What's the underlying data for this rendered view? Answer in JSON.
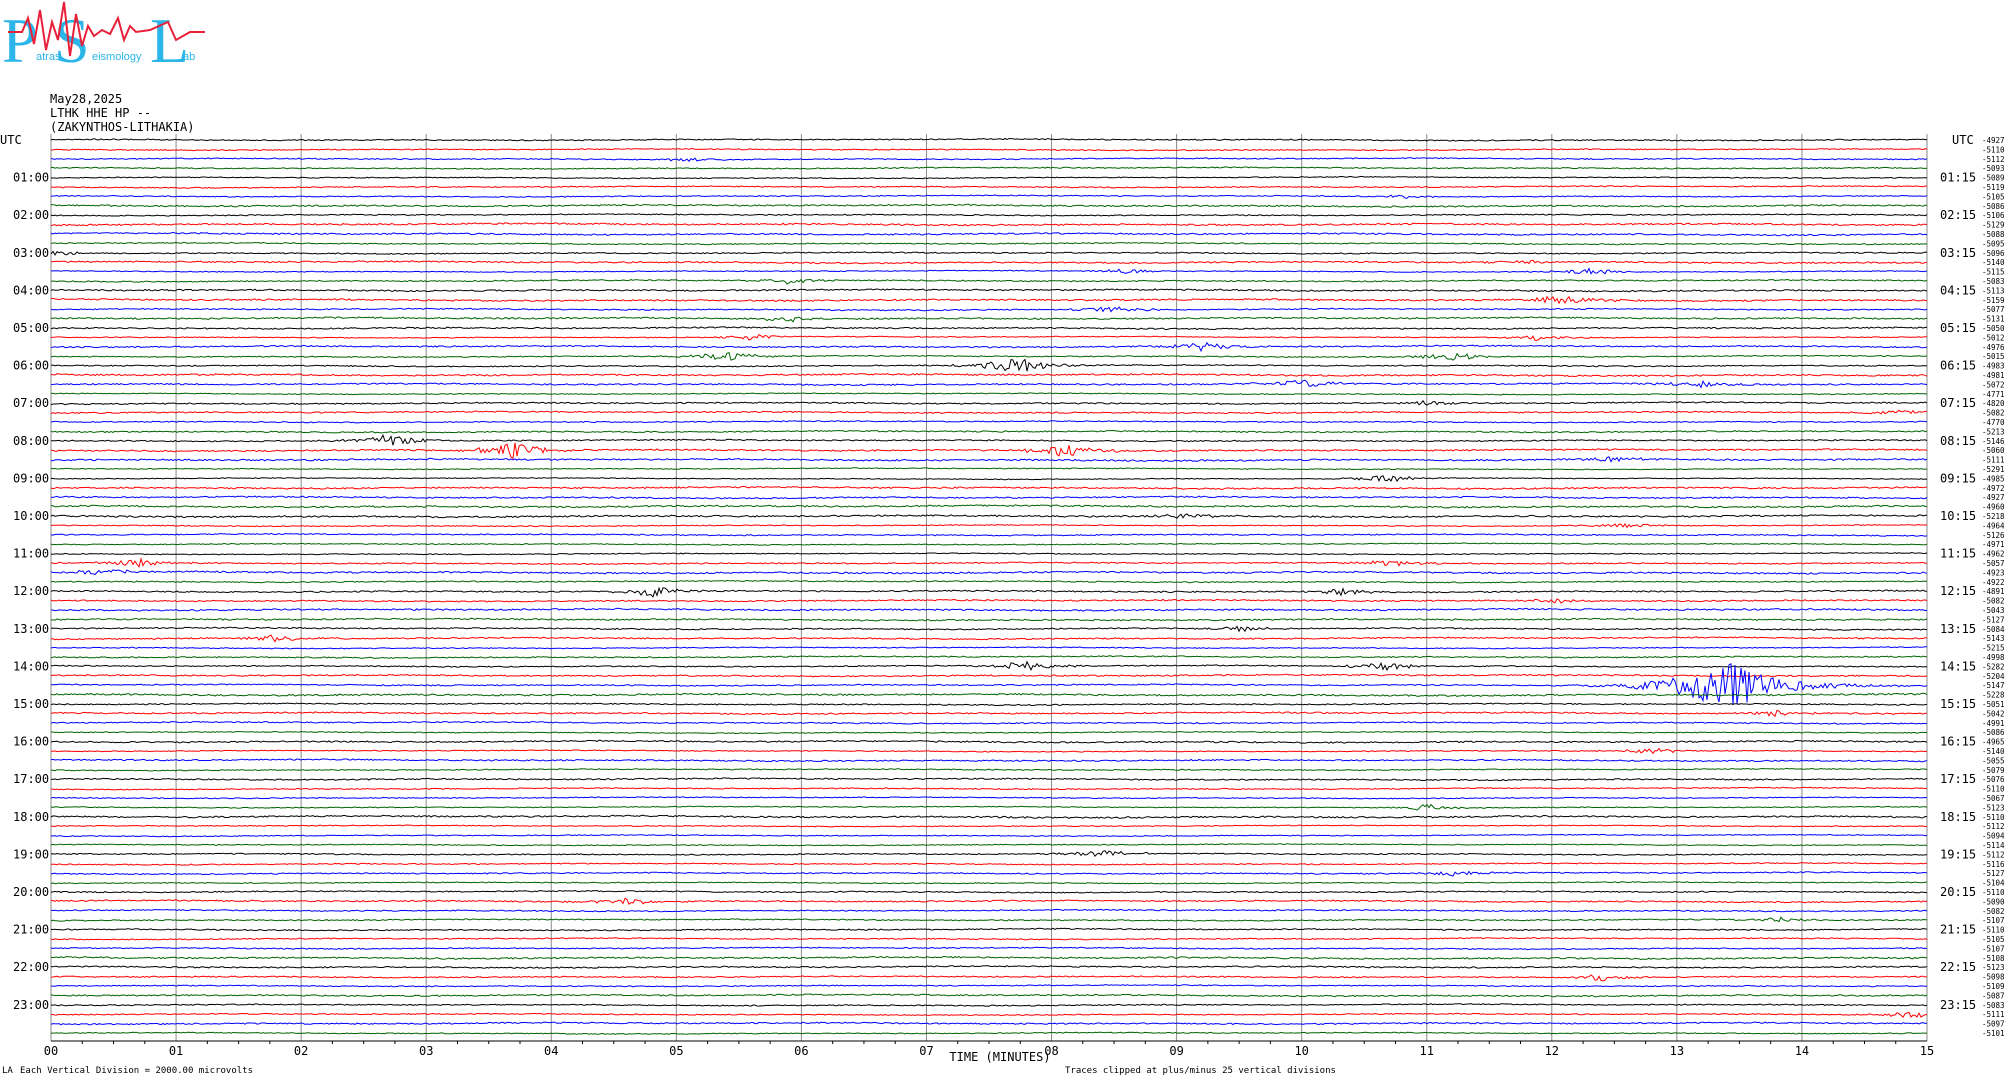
{
  "logo": {
    "big_letters": [
      "P",
      "S",
      "L"
    ],
    "small_words": [
      "atras",
      "eismology",
      "ab"
    ],
    "colors": {
      "letters": "#2bb5e8",
      "wave": "#e8213a"
    }
  },
  "header": {
    "date": "May28,2025",
    "station": "LTHK HHE HP --",
    "location": "(ZAKYNTHOS-LITHAKIA)"
  },
  "utc_label_left": "UTC",
  "utc_label_right": "UTC",
  "hour_labels_left": [
    "01:00",
    "02:00",
    "03:00",
    "04:00",
    "05:00",
    "06:00",
    "07:00",
    "08:00",
    "09:00",
    "10:00",
    "11:00",
    "12:00",
    "13:00",
    "14:00",
    "15:00",
    "16:00",
    "17:00",
    "18:00",
    "19:00",
    "20:00",
    "21:00",
    "22:00",
    "23:00"
  ],
  "hour_labels_right": [
    "01:15",
    "02:15",
    "03:15",
    "04:15",
    "05:15",
    "06:15",
    "07:15",
    "08:15",
    "09:15",
    "10:15",
    "11:15",
    "12:15",
    "13:15",
    "14:15",
    "15:15",
    "16:15",
    "17:15",
    "18:15",
    "19:15",
    "20:15",
    "21:15",
    "22:15",
    "23:15"
  ],
  "footer": {
    "scale_note": "Each Vertical Division = 2000.00 microvolts",
    "axis_title": "TIME (MINUTES)",
    "clip_note": "Traces clipped at plus/minus 25 vertical divisions",
    "corner_mark": "LA"
  },
  "chart_data": {
    "type": "line",
    "title": "",
    "xlabel": "TIME (MINUTES)",
    "ylabel": "",
    "x_ticks": [
      "00",
      "01",
      "02",
      "03",
      "04",
      "05",
      "06",
      "07",
      "08",
      "09",
      "10",
      "11",
      "12",
      "13",
      "14",
      "15"
    ],
    "xlim": [
      0,
      15
    ],
    "trace_count": 96,
    "trace_minutes": 15,
    "grid": true,
    "series_colors": [
      "#000000",
      "#ff0000",
      "#0000ff",
      "#006400"
    ],
    "trace_offsets": [
      "-4927",
      "-5110",
      "-5112",
      "-5093",
      "-5089",
      "-5119",
      "-5105",
      "-5086",
      "-5106",
      "-5129",
      "-5088",
      "-5095",
      "-5096",
      "-5140",
      "-5115",
      "-5083",
      "-5113",
      "-5159",
      "-5077",
      "-5131",
      "-5050",
      "-5012",
      "-4976",
      "-5015",
      "-4983",
      "-4981",
      "-5072",
      "-4771",
      "-4820",
      "-5082",
      "-4770",
      "-5213",
      "-5146",
      "-5060",
      "-5111",
      "-5291",
      "-4985",
      "-4972",
      "-4927",
      "-4960",
      "-5218",
      "-4964",
      "-5126",
      "-4971",
      "-4962",
      "-5057",
      "-4923",
      "-4922",
      "-4891",
      "-5082",
      "-5043",
      "-5127",
      "-5084",
      "-5143",
      "-5215",
      "-4998",
      "-5282",
      "-5204",
      "-5147",
      "-5228",
      "-5051",
      "-5042",
      "-4991",
      "-5086",
      "-4965",
      "-5140",
      "-5055",
      "-5079",
      "-5076",
      "-5110",
      "-5067",
      "-5123",
      "-5110",
      "-5112",
      "-5094",
      "-5114",
      "-5112",
      "-5116",
      "-5127",
      "-5104",
      "-5110",
      "-5090",
      "-5082",
      "-5107",
      "-5110",
      "-5105",
      "-5107",
      "-5108",
      "-5123",
      "-5098",
      "-5109",
      "-5087",
      "-5083",
      "-5111",
      "-5097",
      "-5101"
    ],
    "events": [
      {
        "trace": 2,
        "minute": 5.1,
        "amp": 0.5
      },
      {
        "trace": 6,
        "minute": 10.8,
        "amp": 0.4
      },
      {
        "trace": 12,
        "minute": 0.1,
        "amp": 0.5
      },
      {
        "trace": 13,
        "minute": 11.8,
        "amp": 0.5
      },
      {
        "trace": 14,
        "minute": 8.6,
        "amp": 0.6
      },
      {
        "trace": 14,
        "minute": 12.3,
        "amp": 0.9
      },
      {
        "trace": 15,
        "minute": 5.9,
        "amp": 0.8
      },
      {
        "trace": 17,
        "minute": 12.1,
        "amp": 1.6
      },
      {
        "trace": 18,
        "minute": 8.5,
        "amp": 0.9
      },
      {
        "trace": 19,
        "minute": 5.9,
        "amp": 0.7
      },
      {
        "trace": 21,
        "minute": 5.6,
        "amp": 1.0
      },
      {
        "trace": 21,
        "minute": 11.9,
        "amp": 0.8
      },
      {
        "trace": 22,
        "minute": 9.2,
        "amp": 1.3
      },
      {
        "trace": 23,
        "minute": 5.4,
        "amp": 1.4
      },
      {
        "trace": 23,
        "minute": 11.2,
        "amp": 1.2
      },
      {
        "trace": 24,
        "minute": 7.7,
        "amp": 2.4
      },
      {
        "trace": 26,
        "minute": 10.0,
        "amp": 1.1
      },
      {
        "trace": 26,
        "minute": 13.2,
        "amp": 0.8
      },
      {
        "trace": 28,
        "minute": 11.0,
        "amp": 0.7
      },
      {
        "trace": 29,
        "minute": 14.8,
        "amp": 0.8
      },
      {
        "trace": 32,
        "minute": 2.7,
        "amp": 1.8
      },
      {
        "trace": 33,
        "minute": 3.7,
        "amp": 2.4
      },
      {
        "trace": 33,
        "minute": 8.1,
        "amp": 1.8
      },
      {
        "trace": 34,
        "minute": 12.5,
        "amp": 0.7
      },
      {
        "trace": 36,
        "minute": 10.7,
        "amp": 0.9
      },
      {
        "trace": 40,
        "minute": 9.1,
        "amp": 0.6
      },
      {
        "trace": 41,
        "minute": 12.6,
        "amp": 0.7
      },
      {
        "trace": 45,
        "minute": 0.7,
        "amp": 1.1
      },
      {
        "trace": 45,
        "minute": 10.7,
        "amp": 1.0
      },
      {
        "trace": 46,
        "minute": 0.4,
        "amp": 0.9
      },
      {
        "trace": 48,
        "minute": 4.8,
        "amp": 1.6
      },
      {
        "trace": 48,
        "minute": 10.3,
        "amp": 0.8
      },
      {
        "trace": 49,
        "minute": 12.0,
        "amp": 0.7
      },
      {
        "trace": 52,
        "minute": 9.5,
        "amp": 0.7
      },
      {
        "trace": 53,
        "minute": 1.8,
        "amp": 1.0
      },
      {
        "trace": 56,
        "minute": 7.8,
        "amp": 1.5
      },
      {
        "trace": 56,
        "minute": 10.7,
        "amp": 1.2
      },
      {
        "trace": 58,
        "minute": 13.4,
        "amp": 6.5
      },
      {
        "trace": 61,
        "minute": 13.8,
        "amp": 0.7
      },
      {
        "trace": 65,
        "minute": 12.8,
        "amp": 0.8
      },
      {
        "trace": 71,
        "minute": 11.0,
        "amp": 0.9
      },
      {
        "trace": 76,
        "minute": 8.4,
        "amp": 1.0
      },
      {
        "trace": 78,
        "minute": 11.2,
        "amp": 0.8
      },
      {
        "trace": 81,
        "minute": 4.6,
        "amp": 0.8
      },
      {
        "trace": 83,
        "minute": 13.8,
        "amp": 0.7
      },
      {
        "trace": 89,
        "minute": 12.4,
        "amp": 0.9
      },
      {
        "trace": 93,
        "minute": 14.9,
        "amp": 1.0
      }
    ]
  }
}
